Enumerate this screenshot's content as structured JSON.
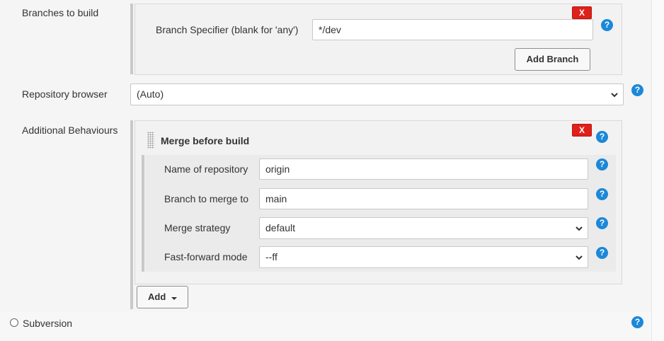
{
  "branches": {
    "label": "Branches to build",
    "specifier_label": "Branch Specifier (blank for 'any')",
    "specifier_value": "*/dev",
    "delete_label": "X",
    "add_branch_label": "Add Branch"
  },
  "repository_browser": {
    "label": "Repository browser",
    "selected": "(Auto)"
  },
  "additional_behaviours": {
    "label": "Additional Behaviours",
    "merge": {
      "title": "Merge before build",
      "delete_label": "X",
      "fields": [
        {
          "label": "Name of repository",
          "value": "origin"
        },
        {
          "label": "Branch to merge to",
          "value": "main"
        },
        {
          "label": "Merge strategy",
          "value": "default"
        },
        {
          "label": "Fast-forward mode",
          "value": "--ff"
        }
      ]
    },
    "add_label": "Add"
  },
  "scm_option": {
    "label": "Subversion"
  },
  "help_glyph": "?",
  "icons": {
    "help": "help-icon",
    "dropdown": "chevron-down-icon",
    "drag": "drag-handle-icon"
  },
  "colors": {
    "help": "#1b88d8",
    "delete": "#e0201a"
  }
}
